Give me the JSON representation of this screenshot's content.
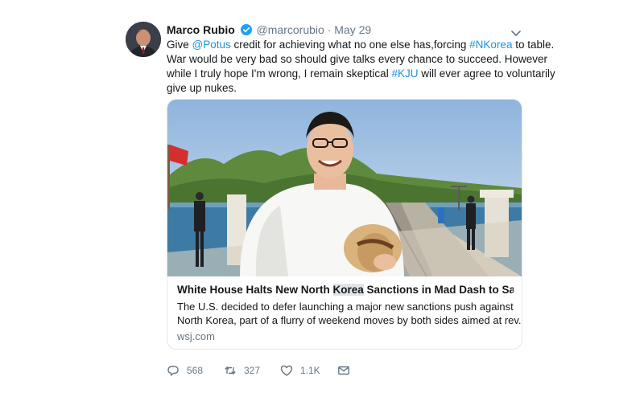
{
  "tweet": {
    "display_name": "Marco Rubio",
    "handle": "@marcorubio",
    "separator": "·",
    "date": "May 29",
    "body": {
      "l1_a": "Give ",
      "l1_mention": "@Potus",
      "l1_b": " credit for achieving what no one else has,forcing ",
      "l1_hashtag": "#NKorea",
      "l1_c": " to table.",
      "l2": "War would be very bad so should give talks every chance to succeed. However",
      "l3_a": "while I truly hope I'm wrong, I remain skeptical ",
      "l3_hashtag": "#KJU",
      "l3_b": " will ever agree to voluntarily",
      "l4": "give up nukes."
    }
  },
  "card": {
    "title_a": "White House Halts New North ",
    "title_highlight": "Korea",
    "title_b": " Sanctions in Mad Dash to Save ...",
    "desc_l1": "The U.S. decided to defer launching a major new sanctions push against",
    "desc_l2": "North Korea, part of a flurry of weekend moves by both sides aimed at rev...",
    "domain": "wsj.com"
  },
  "actions": {
    "reply_count": "568",
    "retweet_count": "327",
    "like_count": "1.1K"
  },
  "icons": {
    "verified": "verified-badge-icon",
    "caret": "chevron-down-icon",
    "reply": "reply-icon",
    "retweet": "retweet-icon",
    "like": "heart-icon",
    "dm": "envelope-icon"
  },
  "colors": {
    "link": "#1b95e0",
    "secondary_text": "#657786",
    "primary_text": "#14171a",
    "border": "#e1e8ed"
  }
}
